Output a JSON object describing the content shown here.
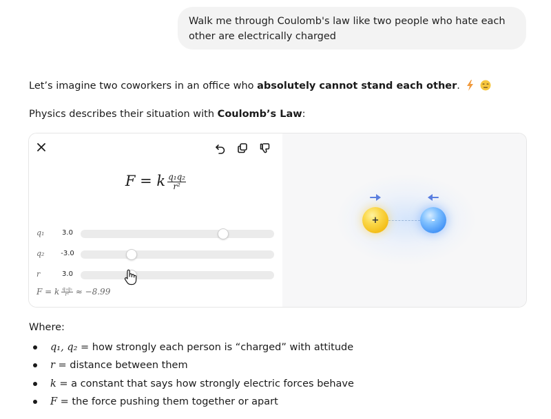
{
  "user_message": "Walk me through Coulomb's law like two people who hate each other are electrically charged",
  "assistant": {
    "intro_prefix": "Let’s imagine two coworkers in an office who ",
    "intro_bold": "absolutely cannot stand each other",
    "intro_suffix": ".",
    "physics_prefix": "Physics describes their situation with ",
    "physics_bold": "Coulomb’s Law",
    "physics_suffix": ":",
    "where_label": "Where:"
  },
  "widget": {
    "icons": {
      "close": "close-icon",
      "undo": "undo-icon",
      "copy": "copy-icon",
      "feedback": "thumbs-down-icon"
    },
    "formula": {
      "lhs": "F = k",
      "numerator": "q₁q₂",
      "denominator": "r²"
    },
    "sliders": [
      {
        "label": "q₁",
        "value": "3.0",
        "level": 0.75
      },
      {
        "label": "q₂",
        "value": "-3.0",
        "level": 0.25
      },
      {
        "label": "r",
        "value": "3.0",
        "level": 0.25
      }
    ],
    "result": {
      "lhs": "F = k",
      "numerator": "q₁q₂",
      "denominator": "r²",
      "approx": "≈ −8.99"
    },
    "visual": {
      "positive_sign": "+",
      "negative_sign": "-",
      "positive_color": "#f6c71f",
      "negative_color": "#4a96f7",
      "arrow_color": "#5b7fe0"
    }
  },
  "definitions": [
    {
      "symbol": "q₁, q₂",
      "text": " = how strongly each person is “charged” with attitude"
    },
    {
      "symbol": "r",
      "text": " = distance between them"
    },
    {
      "symbol": "k",
      "text": " = a constant that says how strongly electric forces behave"
    },
    {
      "symbol": "F",
      "text": " = the force pushing them together or apart"
    }
  ]
}
